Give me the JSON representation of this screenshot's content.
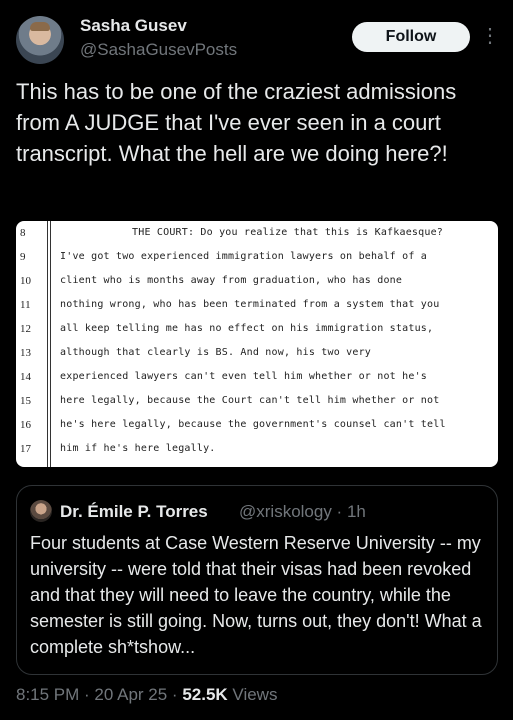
{
  "author": {
    "name": "Sasha Gusev",
    "handle": "@SashaGusevPosts",
    "follow_label": "Follow",
    "more_icon": "more-vertical-icon"
  },
  "tweet_text": "This has to be one of the craziest admissions from A JUDGE that I've ever seen in a court transcript. What the hell are we doing here?!",
  "transcript": {
    "lines": [
      {
        "no": "8",
        "text": "      THE COURT:  Do you realize that this is Kafkaesque?"
      },
      {
        "no": "9",
        "text": "I've got two experienced immigration lawyers on behalf of a"
      },
      {
        "no": "10",
        "text": "client who is months away from graduation, who has done"
      },
      {
        "no": "11",
        "text": "nothing wrong, who has been terminated from a system that you"
      },
      {
        "no": "12",
        "text": "all keep telling me has no effect on his immigration status,"
      },
      {
        "no": "13",
        "text": "although that clearly is BS.  And now, his two very"
      },
      {
        "no": "14",
        "text": "experienced lawyers can't even tell him whether or not he's"
      },
      {
        "no": "15",
        "text": "here legally, because the Court can't tell him whether or not"
      },
      {
        "no": "16",
        "text": "he's here legally, because the government's counsel can't tell"
      },
      {
        "no": "17",
        "text": "him if he's here legally."
      }
    ]
  },
  "quoted_tweet": {
    "name": "Dr. Émile P. Torres",
    "handle": "@xriskology · 1h",
    "text": "Four students at Case Western Reserve University -- my university -- were told that their visas had been revoked and that they will need to leave the country, while the semester is still going. Now, turns out, they don't! What a complete sh*tshow..."
  },
  "meta": {
    "time": "8:15 PM · 20 Apr 25 · ",
    "views_count": "52.5K",
    "views_label": " Views"
  }
}
